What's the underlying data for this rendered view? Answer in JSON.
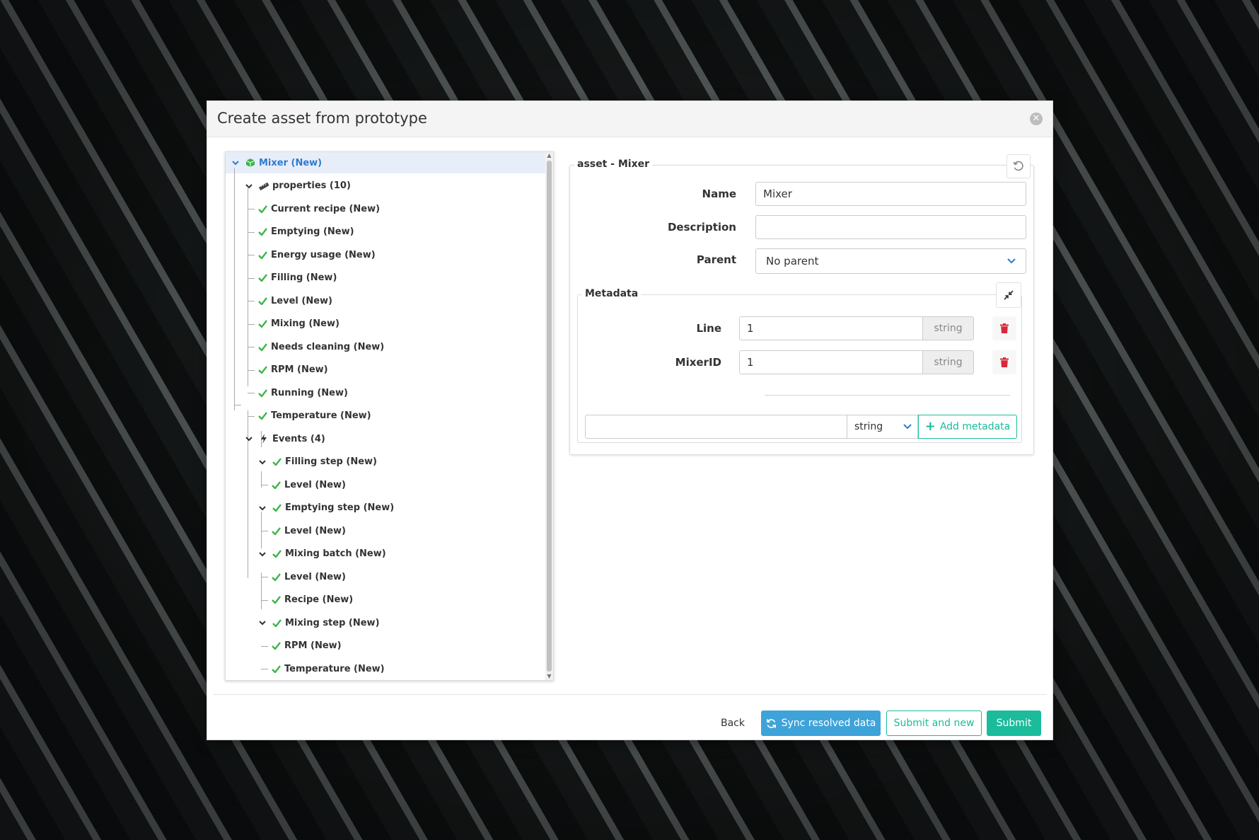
{
  "modal": {
    "title": "Create asset from prototype"
  },
  "tree": {
    "root": "Mixer (New)",
    "properties_group": "properties (10)",
    "properties": [
      "Current recipe (New)",
      "Emptying (New)",
      "Energy usage (New)",
      "Filling (New)",
      "Level (New)",
      "Mixing (New)",
      "Needs cleaning (New)",
      "RPM (New)",
      "Running (New)",
      "Temperature (New)"
    ],
    "events_group": "Events (4)",
    "events": [
      {
        "label": "Filling step (New)",
        "children": [
          "Level (New)"
        ]
      },
      {
        "label": "Emptying step (New)",
        "children": [
          "Level (New)"
        ]
      },
      {
        "label": "Mixing batch (New)",
        "children": [
          "Level (New)",
          "Recipe (New)"
        ]
      },
      {
        "label": "Mixing step (New)",
        "children": [
          "RPM (New)",
          "Temperature (New)"
        ]
      }
    ]
  },
  "form": {
    "legend": "asset - Mixer",
    "name_label": "Name",
    "name_value": "Mixer",
    "description_label": "Description",
    "description_value": "",
    "parent_label": "Parent",
    "parent_value": "No parent",
    "metadata": {
      "legend": "Metadata",
      "rows": [
        {
          "label": "Line",
          "value": "1",
          "type": "string"
        },
        {
          "label": "MixerID",
          "value": "1",
          "type": "string"
        }
      ],
      "new_value": "",
      "new_type": "string",
      "add_label": "Add metadata"
    }
  },
  "footer": {
    "back": "Back",
    "sync": "Sync resolved data",
    "submit_new": "Submit and new",
    "submit": "Submit"
  },
  "colors": {
    "accent_teal": "#1abc9c",
    "sync_blue": "#3ea3d9",
    "check_green": "#3cb54a",
    "trash_red": "#d9283a",
    "root_blue": "#2f7bd0"
  }
}
